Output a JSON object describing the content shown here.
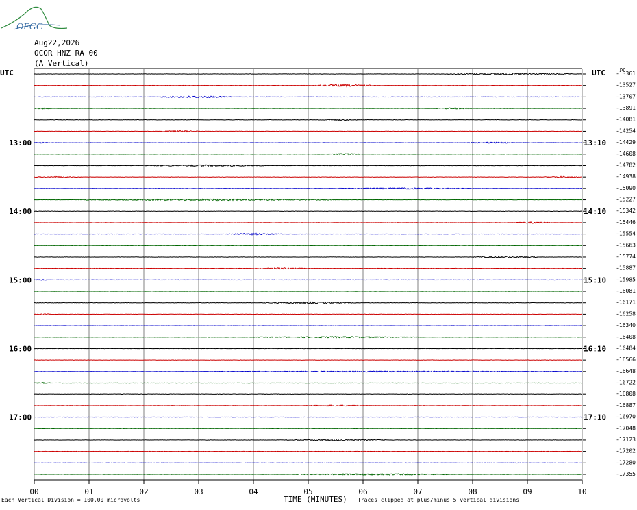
{
  "header": {
    "date": "Aug22,2026",
    "station": "OCOR HNZ RA 00",
    "component": "(A Vertical)"
  },
  "logo": {
    "text": "OFGC",
    "color": "#3a6ea5",
    "accent": "#2e8b3e"
  },
  "colors": {
    "trace_cycle": [
      "#000000",
      "#cc0000",
      "#0000cc",
      "#006600"
    ],
    "grid": "#808080"
  },
  "footer": {
    "scale_note": "Each Vertical Division =  100.00 microvolts",
    "xlabel": "TIME (MINUTES)",
    "clip_note": "Traces clipped at plus/minus 5 vertical divisions"
  },
  "chart_data": {
    "type": "line",
    "title": "",
    "xlabel": "TIME (MINUTES)",
    "x_ticks": [
      "00",
      "01",
      "02",
      "03",
      "04",
      "05",
      "06",
      "07",
      "08",
      "09",
      "10"
    ],
    "xlim": [
      0,
      10
    ],
    "left_axis_label": "UTC",
    "right_axis_label": "UTC",
    "left_time_labels": [
      {
        "row": 6,
        "label": "13:00"
      },
      {
        "row": 12,
        "label": "14:00"
      },
      {
        "row": 18,
        "label": "15:00"
      },
      {
        "row": 24,
        "label": "16:00"
      },
      {
        "row": 30,
        "label": "17:00"
      }
    ],
    "right_time_labels": [
      {
        "row": 6,
        "label": "13:10"
      },
      {
        "row": 12,
        "label": "14:10"
      },
      {
        "row": 18,
        "label": "15:10"
      },
      {
        "row": 24,
        "label": "16:10"
      },
      {
        "row": 30,
        "label": "17:10"
      }
    ],
    "dc_label": "DC",
    "row_offsets": [
      -13361,
      -13527,
      -13707,
      -13891,
      -14081,
      -14254,
      -14429,
      -14608,
      -14782,
      -14938,
      -15090,
      -15227,
      -15342,
      -15446,
      -15554,
      -15663,
      -15774,
      -15887,
      -15985,
      -16081,
      -16171,
      -16258,
      -16340,
      -16408,
      -16484,
      -16566,
      -16648,
      -16722,
      -16808,
      -16887,
      -16970,
      -17048,
      -17123,
      -17202,
      -17280,
      -17355
    ],
    "events": [
      [
        [
          7.5,
          9.8,
          0.6
        ]
      ],
      [
        [
          5.1,
          6.2,
          0.8
        ]
      ],
      [
        [
          2.3,
          3.6,
          0.7
        ]
      ],
      [
        [
          0.0,
          0.3,
          0.5
        ],
        [
          7.3,
          8.0,
          0.5
        ]
      ],
      [
        [
          5.2,
          5.9,
          0.5
        ]
      ],
      [
        [
          2.3,
          3.0,
          0.6
        ]
      ],
      [
        [
          0.0,
          0.3,
          0.4
        ],
        [
          7.9,
          8.8,
          0.5
        ]
      ],
      [
        [
          5.3,
          6.0,
          0.5
        ]
      ],
      [
        [
          2.0,
          4.2,
          0.6
        ]
      ],
      [
        [
          0.0,
          0.8,
          0.4
        ],
        [
          9.3,
          10.0,
          0.5
        ]
      ],
      [
        [
          5.5,
          8.0,
          0.5
        ]
      ],
      [
        [
          0.8,
          5.5,
          0.6
        ]
      ],
      [],
      [
        [
          8.8,
          9.4,
          0.6
        ]
      ],
      [
        [
          3.5,
          4.5,
          0.6
        ]
      ],
      [],
      [
        [
          8.0,
          9.2,
          0.6
        ]
      ],
      [
        [
          4.0,
          5.0,
          0.5
        ]
      ],
      [
        [
          0.0,
          0.3,
          0.4
        ]
      ],
      [],
      [
        [
          4.2,
          5.8,
          0.6
        ]
      ],
      [
        [
          0.0,
          0.3,
          0.4
        ]
      ],
      [],
      [
        [
          4.0,
          7.0,
          0.5
        ]
      ],
      [],
      [],
      [
        [
          3.0,
          9.8,
          0.4
        ]
      ],
      [
        [
          0.0,
          0.3,
          0.5
        ]
      ],
      [],
      [
        [
          5.0,
          6.0,
          0.5
        ]
      ],
      [],
      [],
      [
        [
          4.6,
          6.4,
          0.5
        ]
      ],
      [],
      [],
      [
        [
          4.8,
          7.6,
          0.6
        ]
      ]
    ]
  }
}
